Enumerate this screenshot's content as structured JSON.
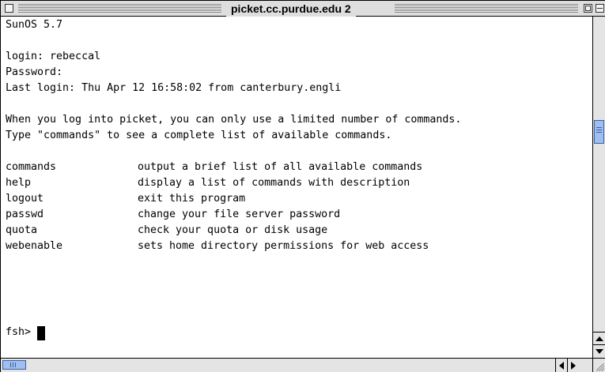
{
  "window": {
    "title": "picket.cc.purdue.edu 2"
  },
  "terminal": {
    "lines": [
      "SunOS 5.7",
      "",
      "login: rebeccal",
      "Password:",
      "Last login: Thu Apr 12 16:58:02 from canterbury.engli",
      "",
      "When you log into picket, you can only use a limited number of commands.",
      "Type \"commands\" to see a complete list of available commands."
    ],
    "commands": [
      {
        "name": "commands",
        "description": "output a brief list of all available commands"
      },
      {
        "name": "help",
        "description": "display a list of commands with description"
      },
      {
        "name": "logout",
        "description": "exit this program"
      },
      {
        "name": "passwd",
        "description": "change your file server password"
      },
      {
        "name": "quota",
        "description": "check your quota or disk usage"
      },
      {
        "name": "webenable",
        "description": "sets home directory permissions for web access"
      }
    ],
    "prompt": "fsh>"
  },
  "icons": {
    "close": "close-box-icon",
    "zoom": "zoom-box-icon",
    "collapse": "collapse-box-icon",
    "resize": "resize-grip-icon"
  },
  "colors": {
    "scroll_thumb": "#9fbfee",
    "title_bar": "#dedede"
  }
}
